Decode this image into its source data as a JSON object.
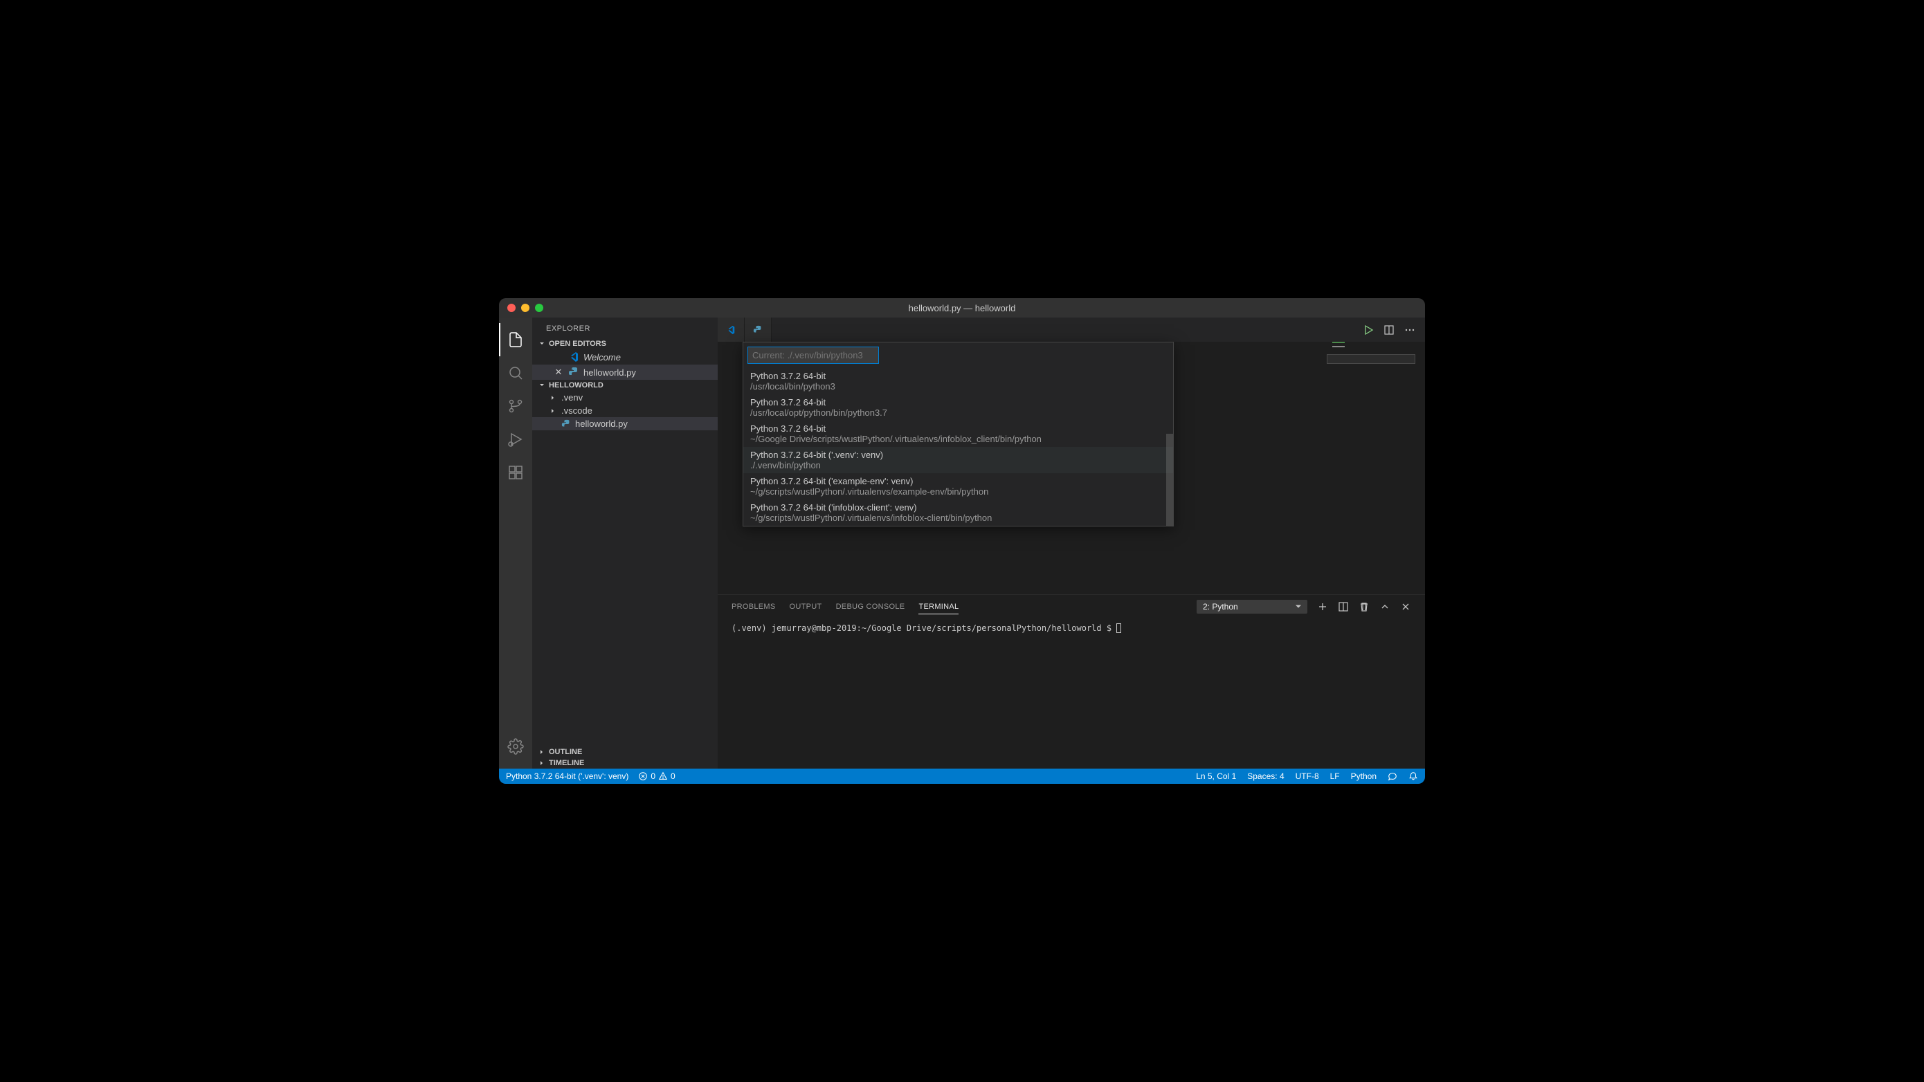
{
  "titlebar": {
    "title": "helloworld.py — helloworld"
  },
  "sidebar": {
    "title": "EXPLORER",
    "openEditors": {
      "label": "OPEN EDITORS",
      "items": [
        {
          "name": "Welcome",
          "icon": "vscode-icon",
          "italic": true,
          "closeVisible": false
        },
        {
          "name": "helloworld.py",
          "icon": "python-icon",
          "italic": false,
          "closeVisible": true,
          "active": true
        }
      ]
    },
    "folder": {
      "label": "HELLOWORLD",
      "items": [
        {
          "name": ".venv",
          "type": "folder"
        },
        {
          "name": ".vscode",
          "type": "folder"
        },
        {
          "name": "helloworld.py",
          "type": "file",
          "icon": "python-icon",
          "selected": true
        }
      ]
    },
    "outline": {
      "label": "OUTLINE"
    },
    "timeline": {
      "label": "TIMELINE"
    }
  },
  "quickpick": {
    "placeholder": "Current: ./.venv/bin/python3",
    "items": [
      {
        "label": "Python 3.7.2 64-bit",
        "desc": "/usr/local/bin/python3"
      },
      {
        "label": "Python 3.7.2 64-bit",
        "desc": "/usr/local/opt/python/bin/python3.7"
      },
      {
        "label": "Python 3.7.2 64-bit",
        "desc": "~/Google Drive/scripts/wustlPython/.virtualenvs/infoblox_client/bin/python"
      },
      {
        "label": "Python 3.7.2 64-bit ('.venv': venv)",
        "desc": "./.venv/bin/python",
        "hover": true
      },
      {
        "label": "Python 3.7.2 64-bit ('example-env': venv)",
        "desc": "~/g/scripts/wustlPython/.virtualenvs/example-env/bin/python"
      },
      {
        "label": "Python 3.7.2 64-bit ('infoblox-client': venv)",
        "desc": "~/g/scripts/wustlPython/.virtualenvs/infoblox-client/bin/python"
      }
    ]
  },
  "panel": {
    "tabs": {
      "problems": "PROBLEMS",
      "output": "OUTPUT",
      "debug": "DEBUG CONSOLE",
      "terminal": "TERMINAL"
    },
    "terminalSelect": "2: Python",
    "terminalLine": "(.venv) jemurray@mbp-2019:~/Google Drive/scripts/personalPython/helloworld $ "
  },
  "statusbar": {
    "interpreter": "Python 3.7.2 64-bit ('.venv': venv)",
    "errors": "0",
    "warnings": "0",
    "position": "Ln 5, Col 1",
    "spaces": "Spaces: 4",
    "encoding": "UTF-8",
    "eol": "LF",
    "language": "Python"
  }
}
